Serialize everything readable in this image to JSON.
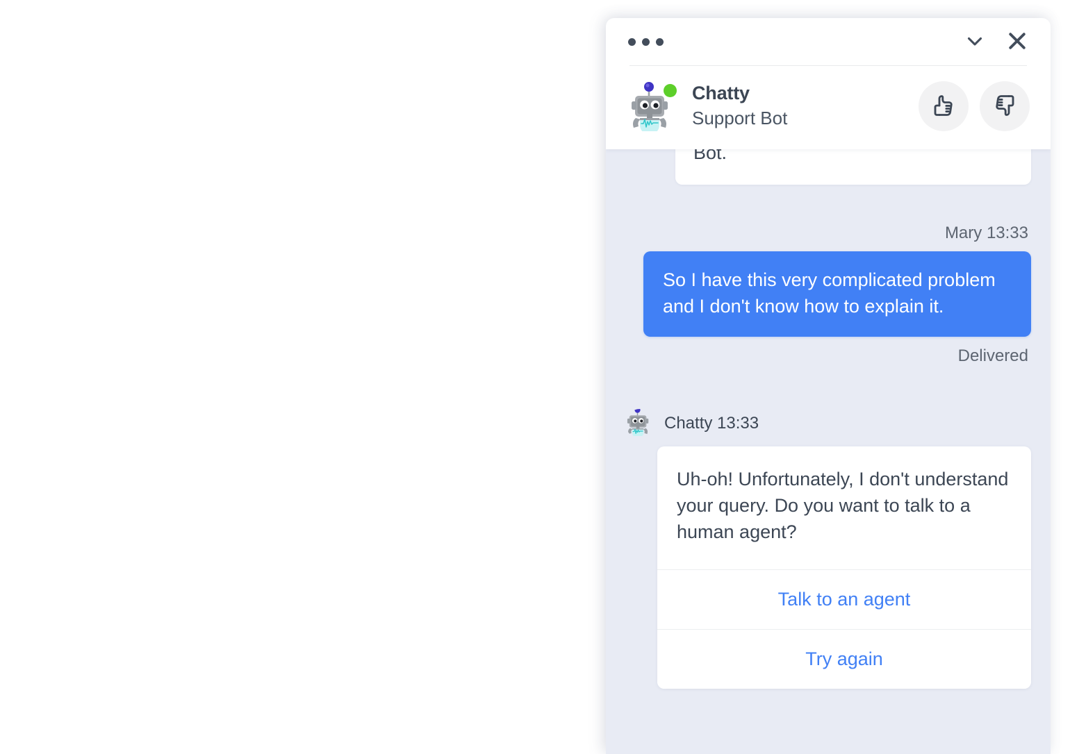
{
  "widget": {
    "header": {
      "menu_icon": "more-horizontal-icon",
      "minimize_icon": "chevron-down-icon",
      "close_icon": "close-icon",
      "bot_name": "Chatty",
      "bot_role": "Support Bot",
      "status": "online",
      "status_color": "#5dcf2a",
      "avatar_icon": "robot-avatar-icon",
      "thumbs_up_icon": "thumbs-up-icon",
      "thumbs_down_icon": "thumbs-down-icon"
    },
    "colors": {
      "accent": "#4180f5",
      "chat_background": "#e8ebf4",
      "panel": "#ffffff",
      "text_dark": "#3c4654",
      "text_meta": "#5d6571",
      "status_online": "#5dcf2a",
      "rating_button_bg": "#f2f2f3"
    },
    "messages": [
      {
        "id": "msg-previous-cut",
        "direction": "incoming",
        "text": "Bot."
      },
      {
        "id": "msg-user-problem",
        "direction": "outgoing",
        "meta": "Mary 13:33",
        "sender": "Mary",
        "time": "13:33",
        "text": "So I have this very complicated problem and I don't know how to explain it.",
        "status": "Delivered"
      },
      {
        "id": "msg-bot-fallback",
        "direction": "incoming",
        "meta": "Chatty 13:33",
        "sender": "Chatty",
        "time": "13:33",
        "text": "Uh-oh! Unfortunately, I don't understand your query. Do you want to talk to a human agent?",
        "actions": [
          {
            "id": "action-talk-to-agent",
            "label": "Talk to an agent"
          },
          {
            "id": "action-try-again",
            "label": "Try again"
          }
        ]
      }
    ]
  }
}
